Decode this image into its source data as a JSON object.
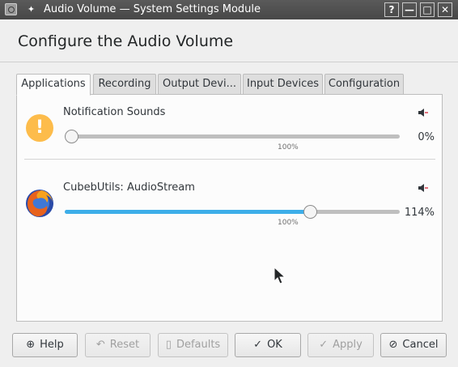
{
  "window": {
    "title": "Audio Volume — System Settings Module",
    "buttons": {
      "help": "?",
      "minimize": "—",
      "maximize": "□",
      "close": "✕"
    }
  },
  "page": {
    "title": "Configure the Audio Volume"
  },
  "tabs": [
    {
      "label": "Applications",
      "active": true
    },
    {
      "label": "Recording",
      "active": false
    },
    {
      "label": "Output Devi...",
      "active": false
    },
    {
      "label": "Input Devices",
      "active": false
    },
    {
      "label": "Configuration",
      "active": false
    }
  ],
  "streams": [
    {
      "name": "Notification Sounds",
      "icon": "warning-icon",
      "volume_percent_label": "0%",
      "volume_fraction_of_max": 0.0,
      "reference_mark": "100%"
    },
    {
      "name": "CubebUtils: AudioStream",
      "icon": "firefox-icon",
      "volume_percent_label": "114%",
      "volume_fraction_of_max": 0.74,
      "reference_mark": "100%"
    }
  ],
  "buttons": {
    "help": "Help",
    "reset": "Reset",
    "defaults": "Defaults",
    "ok": "OK",
    "apply": "Apply",
    "cancel": "Cancel"
  },
  "colors": {
    "accent": "#3daee9",
    "titlebar": "#4f4f4f",
    "warning": "#fdbc4b"
  }
}
